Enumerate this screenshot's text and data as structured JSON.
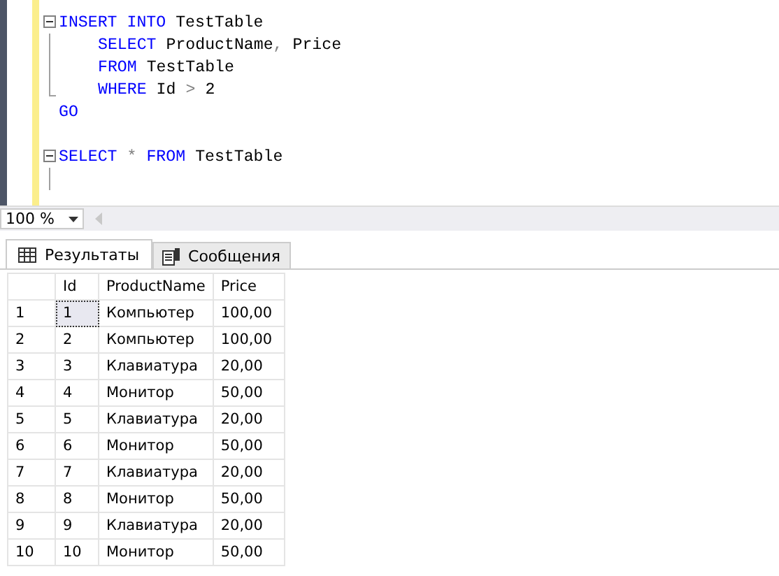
{
  "editor": {
    "lines": [
      {
        "kind": "open",
        "indented": false,
        "tokens": [
          {
            "kind": "keyword",
            "text": "INSERT"
          },
          {
            "kind": "keyword",
            "text": "INTO"
          },
          {
            "kind": "plain",
            "text": "TestTable"
          }
        ]
      },
      {
        "kind": "inner",
        "indented": true,
        "tokens": [
          {
            "kind": "keyword",
            "text": "SELECT"
          },
          {
            "kind": "plain",
            "text": "ProductName"
          },
          {
            "kind": "operator",
            "text": ","
          },
          {
            "kind": "plain",
            "text": "Price"
          }
        ]
      },
      {
        "kind": "inner",
        "indented": true,
        "tokens": [
          {
            "kind": "keyword",
            "text": "FROM"
          },
          {
            "kind": "plain",
            "text": "TestTable"
          }
        ]
      },
      {
        "kind": "close",
        "indented": true,
        "tokens": [
          {
            "kind": "keyword",
            "text": "WHERE"
          },
          {
            "kind": "plain",
            "text": "Id"
          },
          {
            "kind": "operator",
            "text": ">"
          },
          {
            "kind": "plain",
            "text": "2"
          }
        ]
      },
      {
        "kind": "plain",
        "indented": false,
        "tokens": [
          {
            "kind": "keyword",
            "text": "GO"
          }
        ]
      },
      {
        "kind": "plain"
      },
      {
        "kind": "open",
        "indented": false,
        "tokens": [
          {
            "kind": "keyword",
            "text": "SELECT"
          },
          {
            "kind": "operator",
            "text": "*"
          },
          {
            "kind": "keyword",
            "text": "FROM"
          },
          {
            "kind": "plain",
            "text": "TestTable"
          }
        ]
      },
      {
        "kind": "inner"
      }
    ]
  },
  "zoom": {
    "value": "100 %"
  },
  "tabs": [
    {
      "label": "Результаты",
      "selected": true
    },
    {
      "label": "Сообщения",
      "selected": false
    }
  ],
  "table": {
    "columns": [
      "Id",
      "ProductName",
      "Price"
    ],
    "rows": [
      {
        "number": "1",
        "cells": [
          "1",
          "Компьютер",
          "100,00"
        ],
        "focused": true
      },
      {
        "number": "2",
        "cells": [
          "2",
          "Компьютер",
          "100,00"
        ],
        "focused": false
      },
      {
        "number": "3",
        "cells": [
          "3",
          "Клавиатура",
          "20,00"
        ],
        "focused": false
      },
      {
        "number": "4",
        "cells": [
          "4",
          "Монитор",
          "50,00"
        ],
        "focused": false
      },
      {
        "number": "5",
        "cells": [
          "5",
          "Клавиатура",
          "20,00"
        ],
        "focused": false
      },
      {
        "number": "6",
        "cells": [
          "6",
          "Монитор",
          "50,00"
        ],
        "focused": false
      },
      {
        "number": "7",
        "cells": [
          "7",
          "Клавиатура",
          "20,00"
        ],
        "focused": false
      },
      {
        "number": "8",
        "cells": [
          "8",
          "Монитор",
          "50,00"
        ],
        "focused": false
      },
      {
        "number": "9",
        "cells": [
          "9",
          "Клавиатура",
          "20,00"
        ],
        "focused": false
      },
      {
        "number": "10",
        "cells": [
          "10",
          "Монитор",
          "50,00"
        ],
        "focused": false
      }
    ]
  }
}
